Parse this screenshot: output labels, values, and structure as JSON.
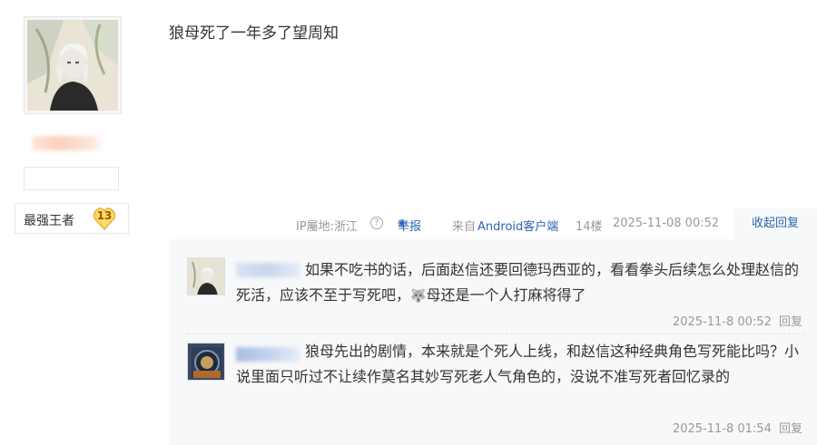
{
  "user": {
    "level_name": "最强王者",
    "level_number": "13"
  },
  "post": {
    "content": "狼母死了一年多了望周知"
  },
  "meta": {
    "ip": "IP屬地:浙江",
    "help": "?",
    "report": "举报",
    "source_prefix": "来自",
    "source_link": "Android客户端",
    "floor": "14楼",
    "time": "2025-11-08 00:52",
    "collapse_replies": "收起回复"
  },
  "replies": [
    {
      "text_before": "如果不吃书的话，后面赵信还要回德玛西亚的，看看拳头后续怎么处理赵信的死活，应该不至于写死吧，",
      "emoji": "🐺",
      "text_after": "母还是一个人打麻将得了",
      "time": "2025-11-8 00:52",
      "reply": "回复"
    },
    {
      "text": "狼母先出的剧情，本来就是个死人上线，和赵信这种经典角色写死能比吗？小说里面只听过不让续作莫名其妙写死老人气角色的，没说不准写死者回忆录的",
      "time": "2025-11-8 01:54",
      "reply": "回复"
    }
  ]
}
